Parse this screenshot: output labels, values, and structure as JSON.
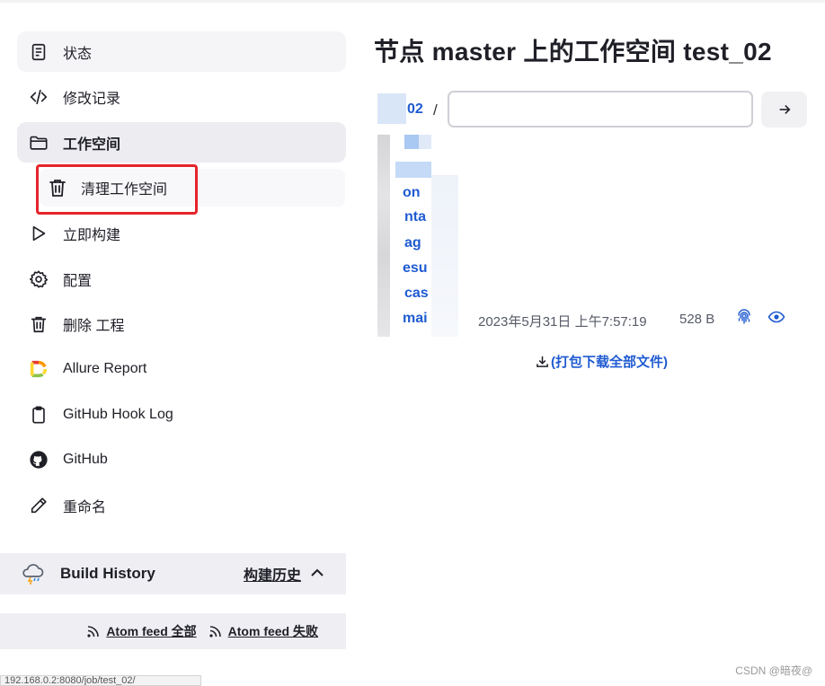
{
  "sidebar": {
    "items": [
      {
        "label": "状态"
      },
      {
        "label": "修改记录"
      },
      {
        "label": "工作空间"
      },
      {
        "label": "清理工作空间"
      },
      {
        "label": "立即构建"
      },
      {
        "label": "配置"
      },
      {
        "label": "删除 工程"
      },
      {
        "label": "Allure Report"
      },
      {
        "label": "GitHub Hook Log"
      },
      {
        "label": "GitHub"
      },
      {
        "label": "重命名"
      }
    ]
  },
  "build_history": {
    "title": "Build History",
    "trend_label": "构建历史",
    "feed_all": "Atom feed 全部",
    "feed_failed": "Atom feed 失败"
  },
  "statusbar": {
    "url": "192.168.0.2:8080/job/test_02/"
  },
  "main": {
    "title": "节点 master 上的工作空间 test_02",
    "breadcrumb": "02",
    "breadcrumb_sep": "/",
    "path_input_value": "",
    "file": {
      "name": "mai",
      "date": "2023年5月31日 上午7:57:19",
      "size": "528 B"
    },
    "file_rows": [
      "",
      "",
      "on",
      "nta",
      "ag",
      "esu",
      "cas"
    ],
    "download_all": "(打包下载全部文件)"
  },
  "watermark": "CSDN @暗夜@",
  "colors": {
    "link": "#1f5bd1",
    "highlight": "#e5242b",
    "active_bg": "#ececf1"
  }
}
